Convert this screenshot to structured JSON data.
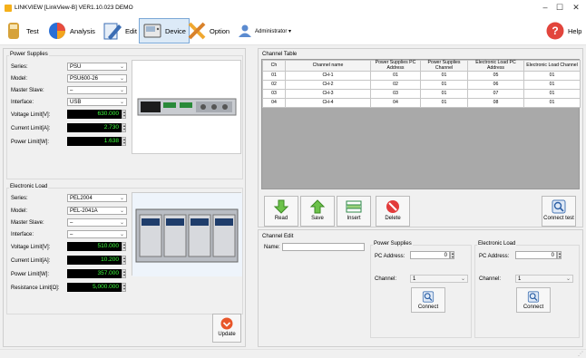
{
  "window": {
    "title": "LINKVIEW [LinkView-B] VER1.10.023 DEMO",
    "minimize": "–",
    "maximize": "☐",
    "close": "✕"
  },
  "toolbar": {
    "test": "Test",
    "analysis": "Analysis",
    "edit": "Edit",
    "device": "Device",
    "option": "Option",
    "user": "Administrator ▾",
    "help": "Help"
  },
  "power_supplies": {
    "title": "Power Supplies",
    "series_label": "Series:",
    "series": "PSU",
    "model_label": "Model:",
    "model": "PSU600-26",
    "master_label": "Master Slave:",
    "master": "–",
    "interface_label": "Interface:",
    "interface": "USB",
    "voltage_label": "Voltage Limit[V]:",
    "voltage": "630.000",
    "current_label": "Current Limit[A]:",
    "current": "2.730",
    "power_label": "Power Limit[W]:",
    "power": "1.638"
  },
  "electronic_load": {
    "title": "Electronic Load",
    "series_label": "Series:",
    "series": "PEL2004",
    "model_label": "Model:",
    "model": "PEL-2041A",
    "master_label": "Master Slave:",
    "master": "–",
    "interface_label": "Interface:",
    "interface": "–",
    "voltage_label": "Voltage Limit[V]:",
    "voltage": "510.000",
    "current_label": "Current Limit[A]:",
    "current": "10.200",
    "power_label": "Power Limit[W]:",
    "power": "357.000",
    "resistance_label": "Resistance Limit[Ω]:",
    "resistance": "5,000.000"
  },
  "update_label": "Update",
  "channel_table": {
    "title": "Channel Table",
    "headers": [
      "Ch",
      "Channel name",
      "Power Supplies PC Address",
      "Power Supplies Channel",
      "Electronic Load PC Address",
      "Electronic Load Channel"
    ],
    "rows": [
      [
        "01",
        "CH-1",
        "01",
        "01",
        "05",
        "01"
      ],
      [
        "02",
        "CH-2",
        "02",
        "01",
        "06",
        "01"
      ],
      [
        "03",
        "CH-3",
        "03",
        "01",
        "07",
        "01"
      ],
      [
        "04",
        "CH-4",
        "04",
        "01",
        "08",
        "01"
      ]
    ]
  },
  "actions": {
    "read": "Read",
    "save": "Save",
    "insert": "Insert",
    "delete": "Delete",
    "connect_test": "Connect test"
  },
  "channel_edit": {
    "title": "Channel Edit",
    "name_label": "Name:",
    "name_value": "",
    "ps_title": "Power Supplies",
    "ps_addr_label": "PC Address:",
    "ps_addr": "0",
    "ps_ch_label": "Channel:",
    "ps_ch": "1",
    "ps_connect": "Connect",
    "el_title": "Electronic Load",
    "el_addr_label": "PC Address:",
    "el_addr": "0",
    "el_ch_label": "Channel:",
    "el_ch": "1",
    "el_connect": "Connect"
  }
}
